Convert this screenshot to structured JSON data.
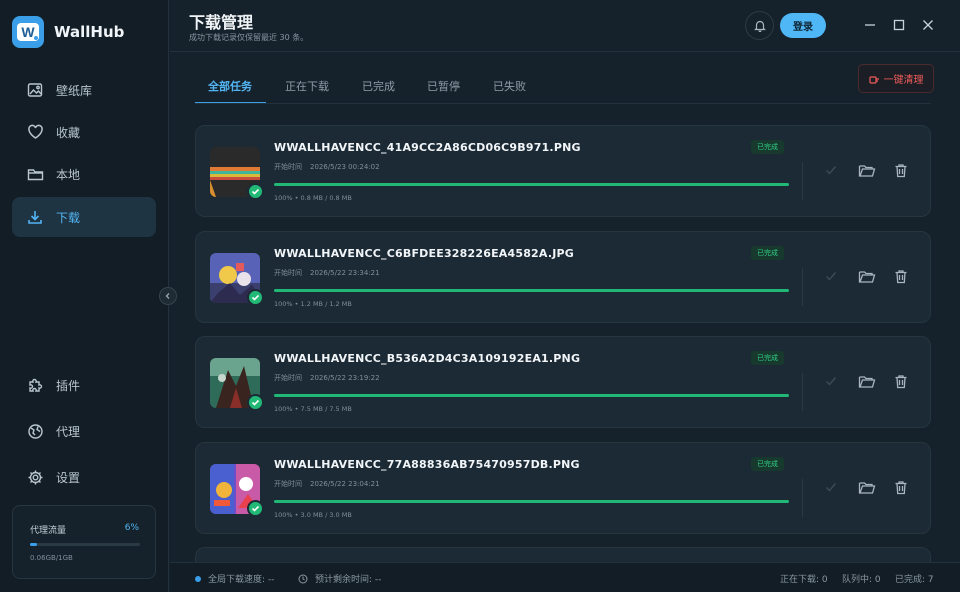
{
  "app": {
    "name": "WallHub",
    "logo_letter": "W"
  },
  "sidebar": {
    "items": [
      {
        "label": "壁纸库",
        "icon": "image-icon",
        "active": false
      },
      {
        "label": "收藏",
        "icon": "heart-icon",
        "active": false
      },
      {
        "label": "本地",
        "icon": "folder-icon",
        "active": false
      },
      {
        "label": "下载",
        "icon": "download-icon",
        "active": true
      },
      {
        "label": "插件",
        "icon": "puzzle-icon",
        "active": false
      },
      {
        "label": "代理",
        "icon": "globe-icon",
        "active": false
      },
      {
        "label": "设置",
        "icon": "gear-icon",
        "active": false
      }
    ],
    "traffic": {
      "label": "代理流量",
      "percent_text": "6%",
      "percent": 0.06,
      "usage": "0.06GB/1GB"
    }
  },
  "header": {
    "title": "下载管理",
    "subtitle": "成功下载记录仅保留最近 30 条。",
    "login_label": "登录"
  },
  "tabs": [
    {
      "label": "全部任务",
      "active": true
    },
    {
      "label": "正在下载",
      "active": false
    },
    {
      "label": "已完成",
      "active": false
    },
    {
      "label": "已暂停",
      "active": false
    },
    {
      "label": "已失败",
      "active": false
    }
  ],
  "clear_button": {
    "label": "一键清理"
  },
  "tasks": [
    {
      "filename": "WWALLHAVENCC_41A9CC2A86CD06C9B971.PNG",
      "start_label": "开始时间",
      "start_time": "2026/5/23 00:24:02",
      "status": "已完成",
      "progress": 1.0,
      "size_info": "100% • 0.8 MB / 0.8 MB"
    },
    {
      "filename": "WWALLHAVENCC_C6BFDEE328226EA4582A.JPG",
      "start_label": "开始时间",
      "start_time": "2026/5/22 23:34:21",
      "status": "已完成",
      "progress": 1.0,
      "size_info": "100% • 1.2 MB / 1.2 MB"
    },
    {
      "filename": "WWALLHAVENCC_B536A2D4C3A109192EA1.PNG",
      "start_label": "开始时间",
      "start_time": "2026/5/22 23:19:22",
      "status": "已完成",
      "progress": 1.0,
      "size_info": "100% • 7.5 MB / 7.5 MB"
    },
    {
      "filename": "WWALLHAVENCC_77A88836AB75470957DB.PNG",
      "start_label": "开始时间",
      "start_time": "2026/5/22 23:04:21",
      "status": "已完成",
      "progress": 1.0,
      "size_info": "100% • 3.0 MB / 3.0 MB"
    }
  ],
  "footer": {
    "speed": "全局下载速度: --",
    "remaining": "预计剩余时间: --",
    "downloading": "正在下载: 0",
    "queued": "队列中: 0",
    "completed": "已完成: 7"
  },
  "colors": {
    "accent": "#3a9ee8",
    "success": "#22b875",
    "danger": "#ef5b5b",
    "background": "#16222b"
  }
}
